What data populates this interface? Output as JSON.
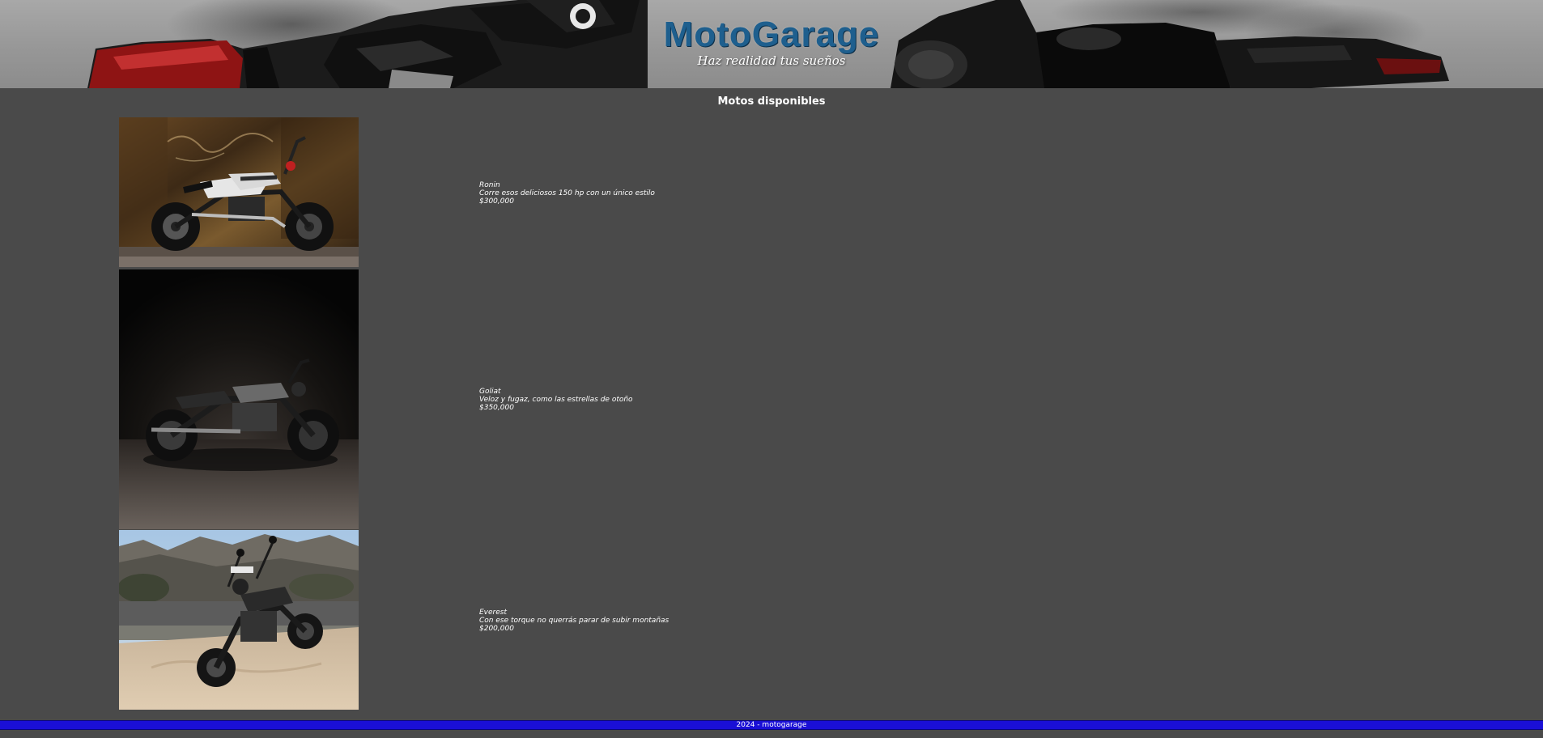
{
  "header": {
    "brand": "MotoGarage",
    "tagline": "Haz realidad tus sueños"
  },
  "section": {
    "title": "Motos disponibles"
  },
  "motos": [
    {
      "name": "Ronin",
      "description": "Corre esos deliciosos 150 hp con un único estilo",
      "price": "$300,000"
    },
    {
      "name": "Goliat",
      "description": "Veloz y fugaz, como las estrellas de otoño",
      "price": "$350,000"
    },
    {
      "name": "Everest",
      "description": "Con ese torque no querrás parar de subir montañas",
      "price": "$200,000"
    }
  ],
  "footer": {
    "text": "2024 - motogarage"
  },
  "colors": {
    "page_background": "#4a4a4a",
    "brand": "#1e5f8e",
    "footer_bar": "#1a0fd6"
  }
}
